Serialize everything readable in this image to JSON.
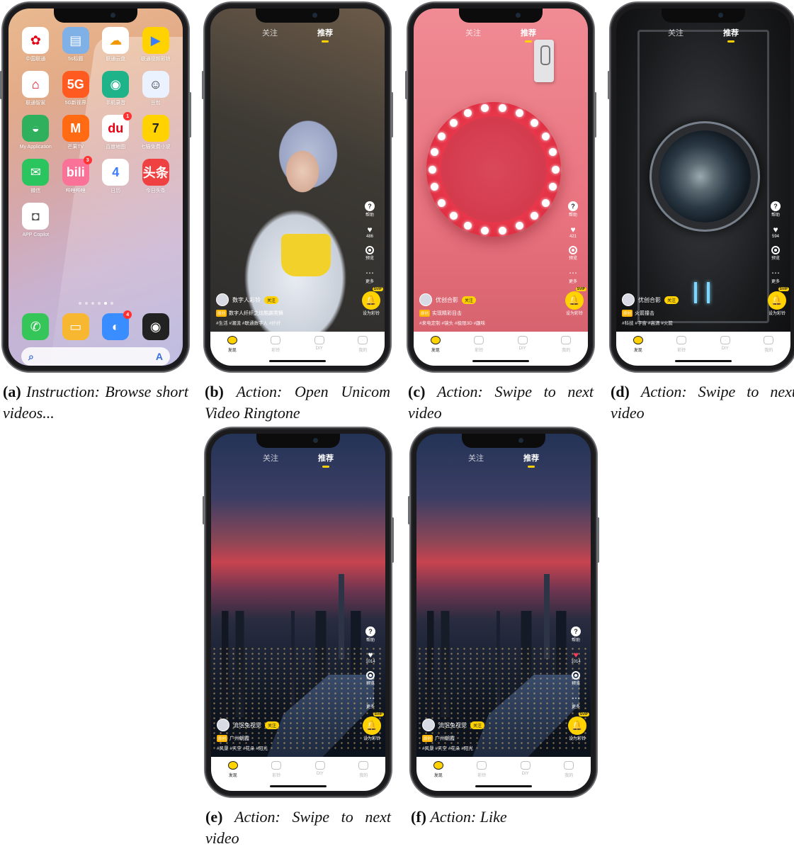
{
  "home": {
    "apps": [
      {
        "label": "中国联通",
        "icon": "china-unicom-icon",
        "color": "#ffffff",
        "glyph": "✿",
        "glyph_color": "#e60012"
      },
      {
        "label": "5s标题",
        "icon": "notes-icon",
        "color": "#7fb0e6",
        "glyph": "▤",
        "glyph_color": "#ffffff"
      },
      {
        "label": "联通云盘",
        "icon": "cloud-drive-icon",
        "color": "#ffffff",
        "glyph": "☁",
        "glyph_color": "#f39800"
      },
      {
        "label": "联通视频彩铃",
        "icon": "video-ringtone-icon",
        "color": "#ffd200",
        "glyph": "▶",
        "glyph_color": "#3b7cff"
      },
      {
        "label": "联通智家",
        "icon": "smart-home-icon",
        "color": "#ffffff",
        "glyph": "⌂",
        "glyph_color": "#e60012"
      },
      {
        "label": "5G新视界",
        "icon": "5g-video-icon",
        "color": "#ff5a1f",
        "glyph": "5G",
        "glyph_color": "#ffffff"
      },
      {
        "label": "手机录音",
        "icon": "voice-recorder-icon",
        "color": "#1fb38a",
        "glyph": "◉",
        "glyph_color": "#ffffff"
      },
      {
        "label": "豆包",
        "icon": "doubao-icon",
        "color": "#eaf2ff",
        "glyph": "☺",
        "glyph_color": "#333333"
      },
      {
        "label": "My Application",
        "icon": "android-icon",
        "color": "#2fb05d",
        "glyph": "◒",
        "glyph_color": "#ffffff"
      },
      {
        "label": "芒果TV",
        "icon": "mango-tv-icon",
        "color": "#ff6a13",
        "glyph": "M",
        "glyph_color": "#ffffff"
      },
      {
        "label": "百度地图",
        "icon": "baidu-map-icon",
        "color": "#ffffff",
        "glyph": "du",
        "glyph_color": "#e60012",
        "badge": "1"
      },
      {
        "label": "七猫免费小说",
        "icon": "qimao-icon",
        "color": "#ffd200",
        "glyph": "7",
        "glyph_color": "#222222"
      },
      {
        "label": "微信",
        "icon": "wechat-icon",
        "color": "#2ac55f",
        "glyph": "✉",
        "glyph_color": "#ffffff"
      },
      {
        "label": "哔哩哔哩",
        "icon": "bilibili-icon",
        "color": "#fb7299",
        "glyph": "bili",
        "glyph_color": "#ffffff",
        "badge": "3"
      },
      {
        "label": "日历",
        "icon": "calendar-icon",
        "color": "#ffffff",
        "glyph": "4",
        "glyph_color": "#3b7cff"
      },
      {
        "label": "今日头条",
        "icon": "toutiao-icon",
        "color": "#f04142",
        "glyph": "头条",
        "glyph_color": "#ffffff"
      },
      {
        "label": "APP Copilot",
        "icon": "app-copilot-icon",
        "color": "#ffffff",
        "glyph": "◘",
        "glyph_color": "#555555"
      }
    ],
    "dock": [
      {
        "icon": "phone-icon",
        "color": "#35c659",
        "glyph": "✆"
      },
      {
        "icon": "notes-icon",
        "color": "#f7b731",
        "glyph": "▭"
      },
      {
        "icon": "browser-icon",
        "color": "#3a8dff",
        "glyph": "◐",
        "badge": "4"
      },
      {
        "icon": "camera-icon",
        "color": "#222222",
        "glyph": "◉"
      }
    ],
    "search_logo": "A"
  },
  "video_ui": {
    "tab_follow": "关注",
    "tab_recommend": "推荐",
    "help": "帮助",
    "preview": "预览",
    "more": "更多",
    "set_ringtone": "设为彩铃",
    "svip": "SVIP",
    "follow_btn": "关注",
    "original": "原创",
    "nav": [
      "发现",
      "彩铃",
      "DIY",
      "我的"
    ]
  },
  "videos": [
    {
      "author": "数字人彩铃",
      "title": "数字人纤纤之炫酷霹雳舞",
      "tags": "#生活 #潮流 #联通数字人 #纤纤",
      "likes": "486"
    },
    {
      "author": "优创合影",
      "title": "实现精彩目击",
      "tags": "#来电定制 #镜头 #极限3D #趣味",
      "likes": "421"
    },
    {
      "author": "优创合影",
      "title": "火箭撞击",
      "tags": "#科技 #宇宙 #高清 #火箭",
      "likes": "594"
    },
    {
      "author": "流氓兔视觉",
      "title": "广州朝霞",
      "tags": "#风景 #天空 #花朵 #阳光",
      "likes": "1014"
    },
    {
      "author": "流氓兔视觉",
      "title": "广州朝霞",
      "tags": "#风景 #天空 #花朵 #阳光",
      "likes": "1014"
    }
  ],
  "captions": [
    {
      "label": "(a)",
      "text": "Instruction: Browse short videos..."
    },
    {
      "label": "(b)",
      "text": "Action: Open Unicom Video Ringtone"
    },
    {
      "label": "(c)",
      "text": "Action: Swipe to next video"
    },
    {
      "label": "(d)",
      "text": "Action: Swipe to next video"
    },
    {
      "label": "(e)",
      "text": "Action: Swipe to next video"
    },
    {
      "label": "(f)",
      "text": "Action: Like"
    }
  ]
}
